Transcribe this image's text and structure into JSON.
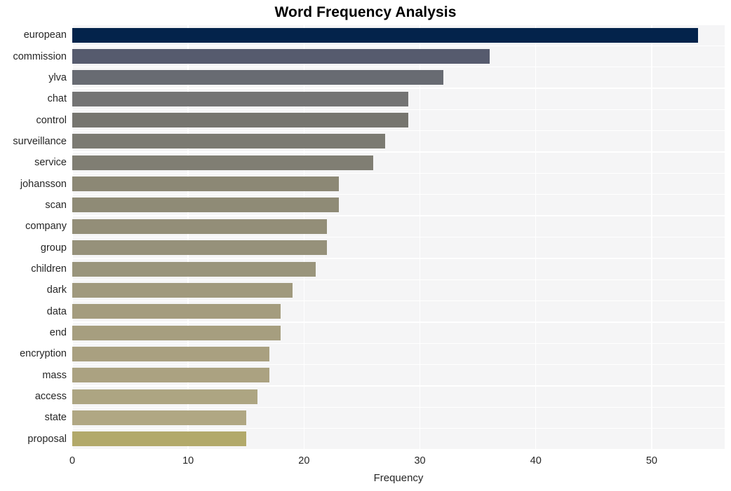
{
  "chart_data": {
    "type": "bar",
    "orientation": "horizontal",
    "title": "Word Frequency Analysis",
    "xlabel": "Frequency",
    "ylabel": "",
    "xlim": [
      0,
      56.3
    ],
    "xticks": [
      0,
      10,
      20,
      30,
      40,
      50
    ],
    "xtick_labels": [
      "0",
      "10",
      "20",
      "30",
      "40",
      "50"
    ],
    "grid": true,
    "grid_color": "#ffffff",
    "plot_background": "#f5f5f6",
    "figure_background": "#ffffff",
    "legend": null,
    "categories": [
      "european",
      "commission",
      "ylva",
      "chat",
      "control",
      "surveillance",
      "service",
      "johansson",
      "scan",
      "company",
      "group",
      "children",
      "dark",
      "data",
      "end",
      "encryption",
      "mass",
      "access",
      "state",
      "proposal"
    ],
    "values": [
      54,
      36,
      32,
      29,
      29,
      27,
      26,
      23,
      23,
      22,
      22,
      21,
      19,
      18,
      18,
      17,
      17,
      16,
      15,
      15
    ],
    "bar_colors": [
      "#03234b",
      "#565b6e",
      "#686b72",
      "#747474",
      "#76756f",
      "#7b7a72",
      "#807e73",
      "#8c8875",
      "#8f8b76",
      "#938e78",
      "#96917a",
      "#9a957c",
      "#a0997d",
      "#a49c7e",
      "#a69e7f",
      "#a9a080",
      "#aba281",
      "#ada582",
      "#b0a783",
      "#b2a96a"
    ]
  }
}
